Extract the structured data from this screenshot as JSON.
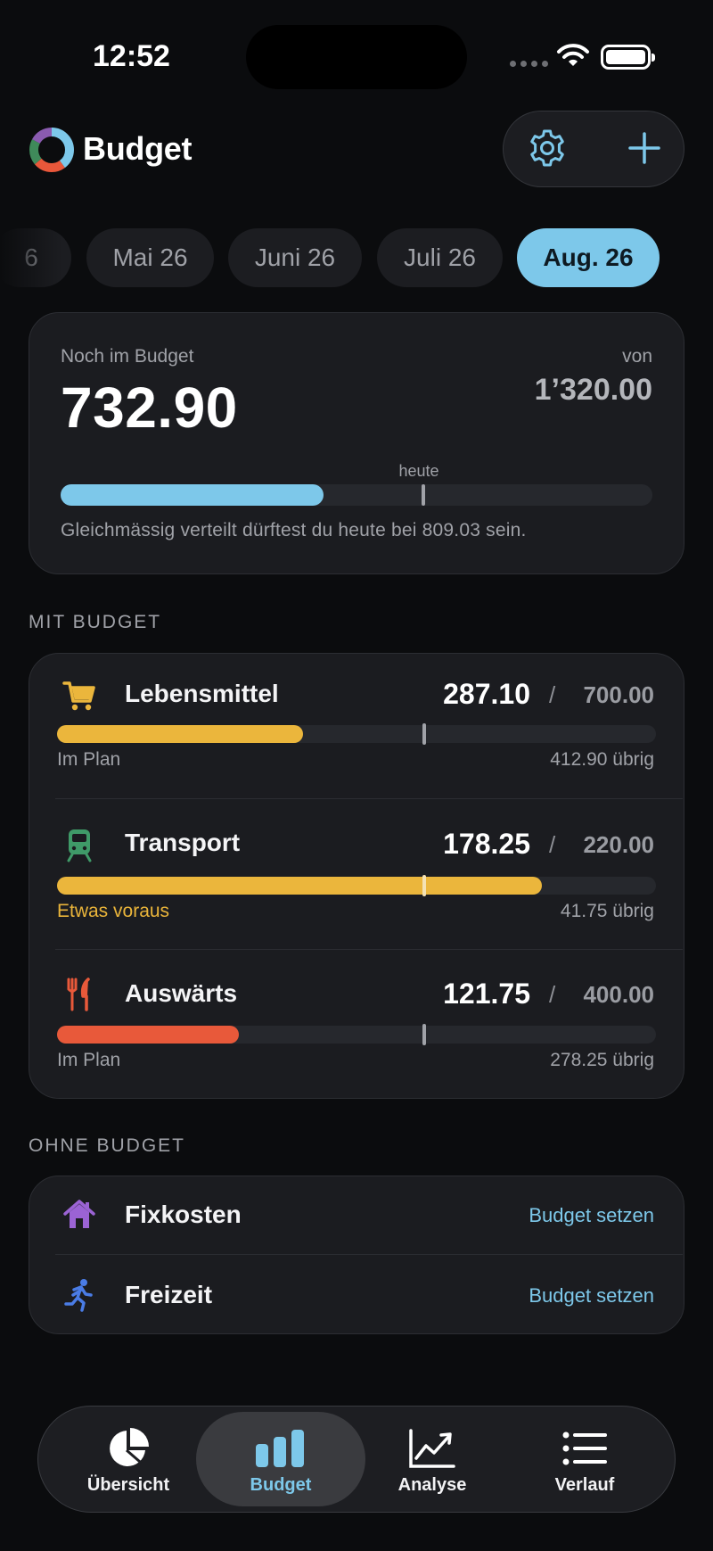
{
  "status_bar": {
    "time": "12:52"
  },
  "header": {
    "app_title": "Budget",
    "icons": [
      "budget-logo-icon",
      "gear-icon",
      "plus-icon"
    ]
  },
  "months": [
    {
      "label": "6",
      "active": false
    },
    {
      "label": "Mai 26",
      "active": false
    },
    {
      "label": "Juni 26",
      "active": false
    },
    {
      "label": "Juli 26",
      "active": false
    },
    {
      "label": "Aug. 26",
      "active": true
    }
  ],
  "summary": {
    "label": "Noch im Budget",
    "remaining": "732.90",
    "von_label": "von",
    "total": "1’320.00",
    "today_label": "heute",
    "progress_fraction": 0.445,
    "today_fraction": 0.613,
    "note": "Gleichmässig verteilt dürftest du heute bei 809.03 sein."
  },
  "sections": {
    "with_budget": "MIT BUDGET",
    "without_budget": "OHNE BUDGET"
  },
  "categories": [
    {
      "name": "Lebensmittel",
      "icon": "cart-icon",
      "spent": "287.10",
      "slash": "/",
      "budget": "700.00",
      "status": "Im Plan",
      "left": "412.90 übrig",
      "fraction": 0.41,
      "today_fraction": 0.613,
      "color": "#ebb63c"
    },
    {
      "name": "Transport",
      "icon": "train-icon",
      "spent": "178.25",
      "slash": "/",
      "budget": "220.00",
      "status": "Etwas voraus",
      "left": "41.75 übrig",
      "fraction": 0.81,
      "today_fraction": 0.613,
      "color": "#ebb63c"
    },
    {
      "name": "Auswärts",
      "icon": "fork-knife-icon",
      "spent": "121.75",
      "slash": "/",
      "budget": "400.00",
      "status": "Im Plan",
      "left": "278.25 übrig",
      "fraction": 0.304,
      "today_fraction": 0.613,
      "color": "#e8593a"
    }
  ],
  "no_budget": [
    {
      "name": "Fixkosten",
      "icon": "house-icon",
      "action": "Budget setzen"
    },
    {
      "name": "Freizeit",
      "icon": "runner-icon",
      "action": "Budget setzen"
    }
  ],
  "tabs": [
    {
      "label": "Übersicht",
      "icon": "pie-chart-icon",
      "active": false
    },
    {
      "label": "Budget",
      "icon": "bar-chart-icon",
      "active": true
    },
    {
      "label": "Analyse",
      "icon": "line-chart-icon",
      "active": false
    },
    {
      "label": "Verlauf",
      "icon": "list-icon",
      "active": false
    }
  ],
  "colors": {
    "accent": "#7dc8ea",
    "on_track": "#ebb63c",
    "warning": "#e8593a",
    "background": "#0b0c0e",
    "card": "#1b1c20"
  }
}
